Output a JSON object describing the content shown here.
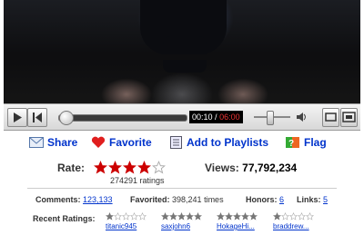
{
  "video": {
    "time_current": "00:10",
    "time_total": "06:00",
    "progress": 0.05,
    "volume": 0.4
  },
  "actions": {
    "share": "Share",
    "favorite": "Favorite",
    "add_to_playlists": "Add to Playlists",
    "flag": "Flag"
  },
  "rating": {
    "label": "Rate:",
    "stars": 4,
    "max_stars": 5,
    "count_text": "274291 ratings"
  },
  "views": {
    "label": "Views:",
    "value": "77,792,234"
  },
  "info": {
    "comments_label": "Comments:",
    "comments_value": "123,133",
    "favorited_label": "Favorited:",
    "favorited_value": "398,241 times",
    "honors_label": "Honors:",
    "honors_value": "6",
    "links_label": "Links:",
    "links_value": "5"
  },
  "recent_ratings": {
    "label": "Recent Ratings:",
    "items": [
      {
        "user": "titanic945",
        "stars": 1
      },
      {
        "user": "saxjohn6",
        "stars": 5
      },
      {
        "user": "HokageHi...",
        "stars": 5
      },
      {
        "user": "braddrew...",
        "stars": 1
      }
    ]
  },
  "colors": {
    "link": "#0033cc",
    "star": "#cc0000",
    "progress": "#dd1111"
  }
}
